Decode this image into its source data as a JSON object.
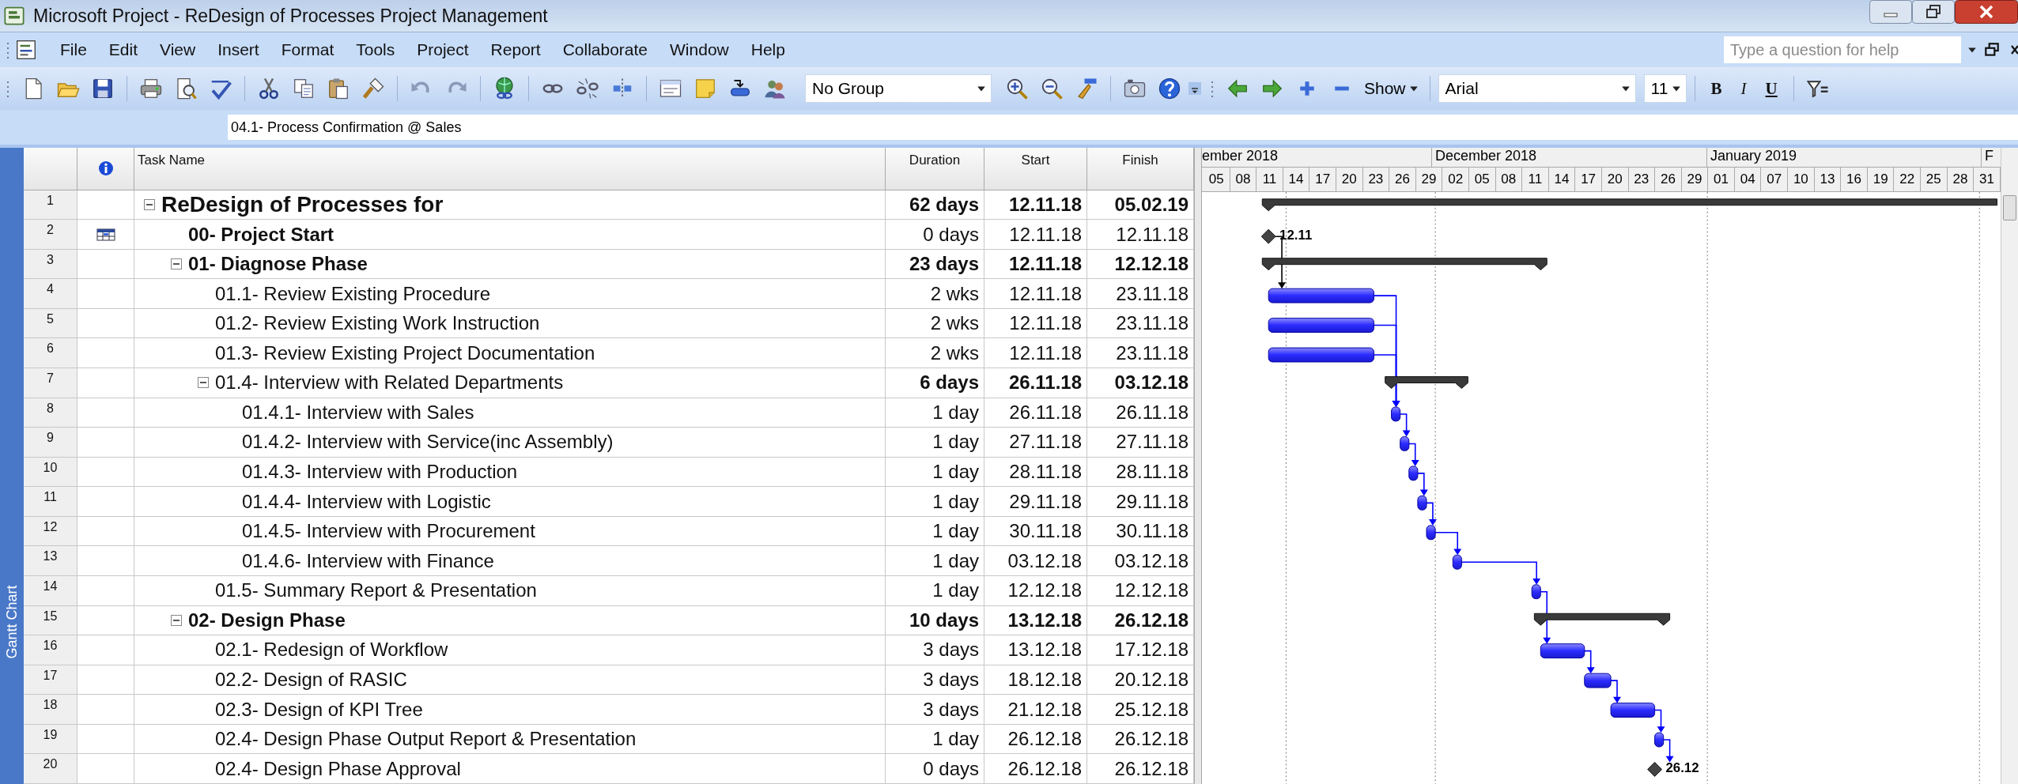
{
  "window": {
    "title": "Microsoft Project - ReDesign of Processes Project Management"
  },
  "menu": [
    "File",
    "Edit",
    "View",
    "Insert",
    "Format",
    "Tools",
    "Project",
    "Report",
    "Collaborate",
    "Window",
    "Help"
  ],
  "help_box": {
    "placeholder": "Type a question for help"
  },
  "toolbar": {
    "group": "No Group",
    "show_button": "Show",
    "font": "Arial",
    "font_size": "11",
    "format_buttons": [
      "B",
      "I",
      "U"
    ]
  },
  "entry_bar": {
    "value": "04.1- Process Confirmation @ Sales"
  },
  "view_bar": {
    "label": "Gantt Chart"
  },
  "table": {
    "columns": [
      "Task Name",
      "Duration",
      "Start",
      "Finish"
    ],
    "tasks": [
      {
        "row_number": "1",
        "name": "ReDesign of Processes for",
        "duration": "62 days",
        "start": "12.11.18",
        "finish": "05.02.19",
        "kind": "summary",
        "expanded": true,
        "indicator": false,
        "children": [
          {
            "row_number": "2",
            "name": "00- Project Start",
            "duration": "0 days",
            "start": "12.11.18",
            "finish": "12.11.18",
            "kind": "milestone",
            "indicator": true,
            "bar_label": "12.11"
          },
          {
            "row_number": "3",
            "name": "01- Diagnose Phase",
            "duration": "23 days",
            "start": "12.11.18",
            "finish": "12.12.18",
            "kind": "summary",
            "expanded": true,
            "indicator": false,
            "children": [
              {
                "row_number": "4",
                "name": "01.1- Review Existing Procedure",
                "duration": "2 wks",
                "start": "12.11.18",
                "finish": "23.11.18",
                "kind": "task",
                "indicator": false
              },
              {
                "row_number": "5",
                "name": "01.2- Review Existing Work Instruction",
                "duration": "2 wks",
                "start": "12.11.18",
                "finish": "23.11.18",
                "kind": "task",
                "indicator": false
              },
              {
                "row_number": "6",
                "name": "01.3- Review Existing Project Documentation",
                "duration": "2 wks",
                "start": "12.11.18",
                "finish": "23.11.18",
                "kind": "task",
                "indicator": false
              },
              {
                "row_number": "7",
                "name": "01.4- Interview with Related Departments",
                "duration": "6 days",
                "start": "26.11.18",
                "finish": "03.12.18",
                "kind": "summary",
                "expanded": true,
                "indicator": false,
                "children": [
                  {
                    "row_number": "8",
                    "name": "01.4.1- Interview with Sales",
                    "duration": "1 day",
                    "start": "26.11.18",
                    "finish": "26.11.18",
                    "kind": "task",
                    "indicator": false
                  },
                  {
                    "row_number": "9",
                    "name": "01.4.2- Interview with Service(inc Assembly)",
                    "duration": "1 day",
                    "start": "27.11.18",
                    "finish": "27.11.18",
                    "kind": "task",
                    "indicator": false
                  },
                  {
                    "row_number": "10",
                    "name": "01.4.3- Interview with Production",
                    "duration": "1 day",
                    "start": "28.11.18",
                    "finish": "28.11.18",
                    "kind": "task",
                    "indicator": false
                  },
                  {
                    "row_number": "11",
                    "name": "01.4.4- Interview with Logistic",
                    "duration": "1 day",
                    "start": "29.11.18",
                    "finish": "29.11.18",
                    "kind": "task",
                    "indicator": false
                  },
                  {
                    "row_number": "12",
                    "name": "01.4.5- Interview with Procurement",
                    "duration": "1 day",
                    "start": "30.11.18",
                    "finish": "30.11.18",
                    "kind": "task",
                    "indicator": false
                  },
                  {
                    "row_number": "13",
                    "name": "01.4.6- Interview with Finance",
                    "duration": "1 day",
                    "start": "03.12.18",
                    "finish": "03.12.18",
                    "kind": "task",
                    "indicator": false
                  }
                ]
              },
              {
                "row_number": "14",
                "name": "01.5- Summary Report & Presentation",
                "duration": "1 day",
                "start": "12.12.18",
                "finish": "12.12.18",
                "kind": "task",
                "indicator": false
              }
            ]
          },
          {
            "row_number": "15",
            "name": "02- Design Phase",
            "duration": "10 days",
            "start": "13.12.18",
            "finish": "26.12.18",
            "kind": "summary",
            "expanded": true,
            "indicator": false,
            "children": [
              {
                "row_number": "16",
                "name": "02.1- Redesign of Workflow",
                "duration": "3 days",
                "start": "13.12.18",
                "finish": "17.12.18",
                "kind": "task",
                "indicator": false
              },
              {
                "row_number": "17",
                "name": "02.2- Design of RASIC",
                "duration": "3 days",
                "start": "18.12.18",
                "finish": "20.12.18",
                "kind": "task",
                "indicator": false
              },
              {
                "row_number": "18",
                "name": "02.3- Design of KPI Tree",
                "duration": "3 days",
                "start": "21.12.18",
                "finish": "25.12.18",
                "kind": "task",
                "indicator": false
              },
              {
                "row_number": "19",
                "name": "02.4- Design Phase Output Report & Presentation",
                "duration": "1 day",
                "start": "26.12.18",
                "finish": "26.12.18",
                "kind": "task",
                "indicator": false
              },
              {
                "row_number": "20",
                "name": "02.4- Design Phase Approval",
                "duration": "0 days",
                "start": "26.12.18",
                "finish": "26.12.18",
                "kind": "milestone",
                "indicator": false,
                "bar_label": "26.12"
              }
            ]
          }
        ]
      }
    ]
  },
  "timescale": {
    "months": [
      "ember 2018",
      "December 2018",
      "January 2019",
      "F"
    ],
    "days": [
      "05",
      "08",
      "11",
      "14",
      "17",
      "20",
      "23",
      "26",
      "29",
      "02",
      "05",
      "08",
      "11",
      "14",
      "17",
      "20",
      "23",
      "26",
      "29",
      "01",
      "04",
      "07",
      "10",
      "13",
      "16",
      "19",
      "22",
      "25",
      "28",
      "31"
    ]
  }
}
